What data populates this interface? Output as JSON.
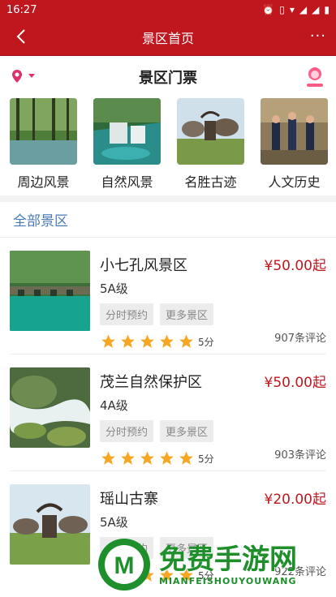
{
  "status_bar": {
    "time": "16:27"
  },
  "header": {
    "title": "景区首页",
    "more": "···"
  },
  "sub_header": {
    "title": "景区门票"
  },
  "categories": [
    {
      "label": "周边风景"
    },
    {
      "label": "自然风景"
    },
    {
      "label": "名胜古迹"
    },
    {
      "label": "人文历史"
    }
  ],
  "section": {
    "title": "全部景区"
  },
  "spots": [
    {
      "name": "小七孔风景区",
      "level": "5A级",
      "price": "¥50.00起",
      "tag1": "分时预约",
      "tag2": "更多景区",
      "score": "5分",
      "reviews": "907条评论",
      "stars": 5
    },
    {
      "name": "茂兰自然保护区",
      "level": "4A级",
      "price": "¥50.00起",
      "tag1": "分时预约",
      "tag2": "更多景区",
      "score": "5分",
      "reviews": "903条评论",
      "stars": 5
    },
    {
      "name": "瑶山古寨",
      "level": "5A级",
      "price": "¥20.00起",
      "tag1": "分时预约",
      "tag2": "更多景区",
      "score": "5分",
      "reviews": "922条评论",
      "stars": 5
    }
  ],
  "watermark": {
    "main": "免费手游网",
    "sub": "MIANFEISHOUYOUWANG"
  },
  "colors": {
    "brand": "#c0161e",
    "accent_link": "#4a7ab8",
    "star": "#f5a623"
  }
}
